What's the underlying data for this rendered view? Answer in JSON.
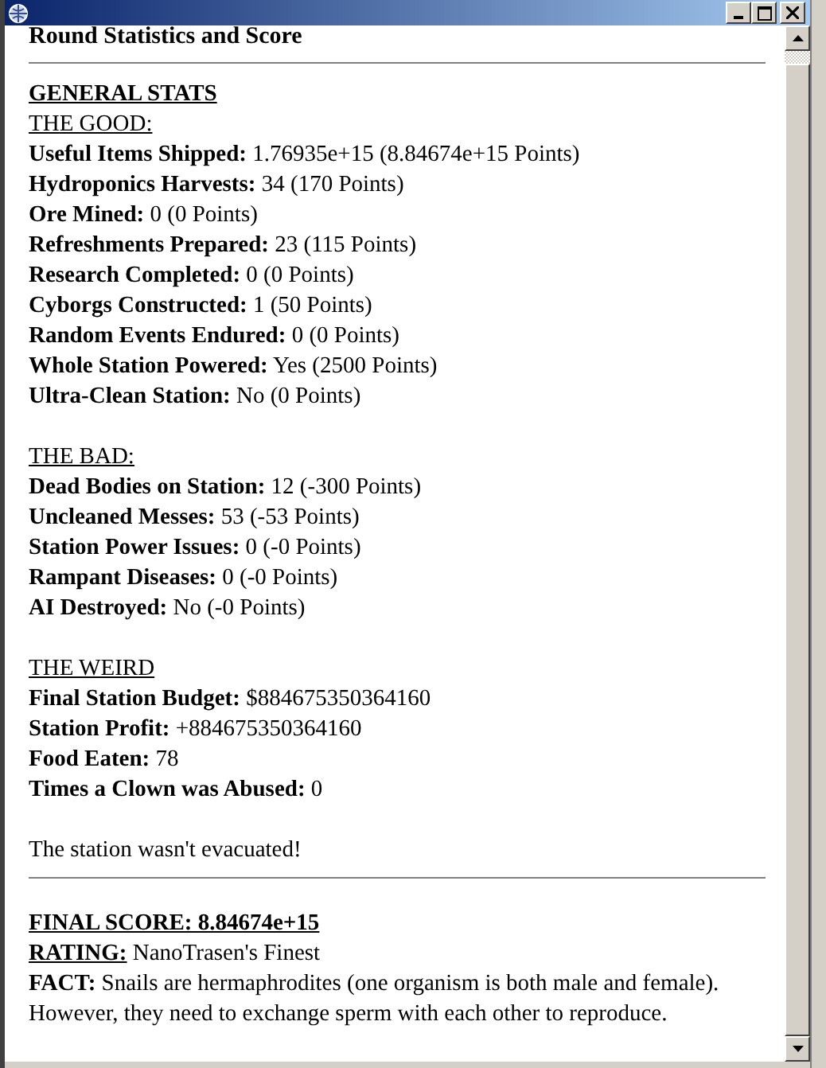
{
  "header": "Round Statistics and Score",
  "general_heading": "GENERAL STATS",
  "groups": [
    {
      "title": "THE GOOD:",
      "stats": [
        "**Useful Items Shipped:** 1.76935e+15 (8.84674e+15 Points)",
        "**Hydroponics Harvests:** 34 (170 Points)",
        "**Ore Mined:** 0 (0 Points)",
        "**Refreshments Prepared:** 23 (115 Points)",
        "**Research Completed:** 0 (0 Points)",
        "**Cyborgs Constructed:** 1 (50 Points)",
        "**Random Events Endured:** 0 (0 Points)",
        "**Whole Station Powered:** Yes (2500 Points)",
        "**Ultra-Clean Station:** No (0 Points)"
      ]
    },
    {
      "title": "THE BAD:",
      "stats": [
        "**Dead Bodies on Station:** 12 (-300 Points)",
        "**Uncleaned Messes:** 53 (-53 Points)",
        "**Station Power Issues:** 0 (-0 Points)",
        "**Rampant Diseases:** 0 (-0 Points)",
        "**AI Destroyed:** No (-0 Points)"
      ]
    },
    {
      "title": "THE WEIRD",
      "stats": [
        "**Final Station Budget:** $884675350364160",
        "**Station Profit:** +884675350364160",
        "**Food Eaten:** 78",
        "**Times a Clown was Abused:** 0"
      ]
    }
  ],
  "evacuation_note": "The station wasn't evacuated!",
  "final_score": "FINAL SCORE: 8.84674e+15",
  "rating": {
    "label": "RATING:",
    "value": "NanoTrasen's Finest"
  },
  "fact": "**FACT:** Snails are hermaphrodites (one organism is both male and female). However, they need to exchange sperm with each other to reproduce."
}
